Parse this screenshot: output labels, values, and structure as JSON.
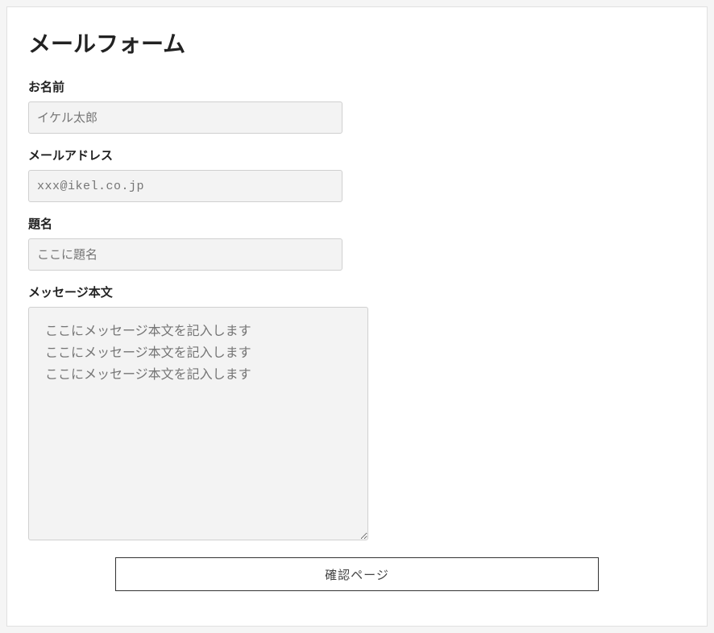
{
  "form": {
    "title": "メールフォーム",
    "fields": {
      "name": {
        "label": "お名前",
        "placeholder": "イケル太郎"
      },
      "email": {
        "label": "メールアドレス",
        "placeholder": "xxx@ikel.co.jp"
      },
      "subject": {
        "label": "題名",
        "placeholder": "ここに題名"
      },
      "message": {
        "label": "メッセージ本文",
        "placeholder": "ここにメッセージ本文を記入します\nここにメッセージ本文を記入します\nここにメッセージ本文を記入します"
      }
    },
    "submit_label": "確認ページ"
  }
}
